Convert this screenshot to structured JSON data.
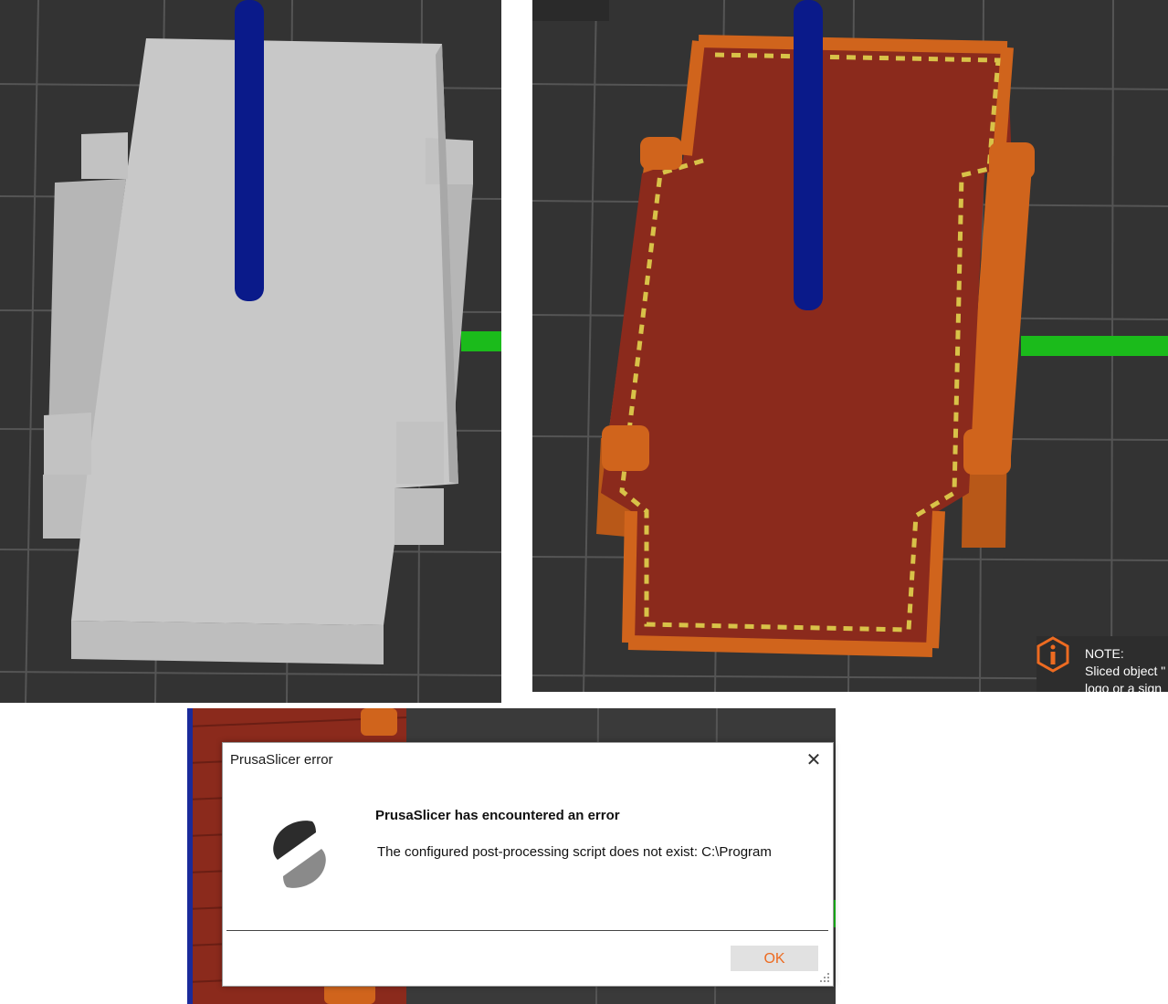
{
  "right_panel": {
    "note": {
      "title": "NOTE:",
      "text": "Sliced object \"",
      "text2": "logo or a sign",
      "icon": "info-hexagon-icon",
      "accent": "#ed6b21"
    }
  },
  "dialog": {
    "title": "PrusaSlicer error",
    "heading": "PrusaSlicer has encountered an error",
    "message": "The configured post-processing script does not exist: C:\\Program",
    "ok_label": "OK",
    "logo": "prusaslicer-logo",
    "close_icon": "close-icon"
  },
  "colors": {
    "viewport_bg": "#333333",
    "model_gray": "#c8c8c8",
    "perimeter_orange": "#d0641c",
    "infill_red": "#8b2a1c",
    "top_yellow": "#d8c248",
    "axis_blue": "#0a1a8a",
    "axis_green": "#1bbb1b",
    "ok_text": "#ed6b21"
  }
}
